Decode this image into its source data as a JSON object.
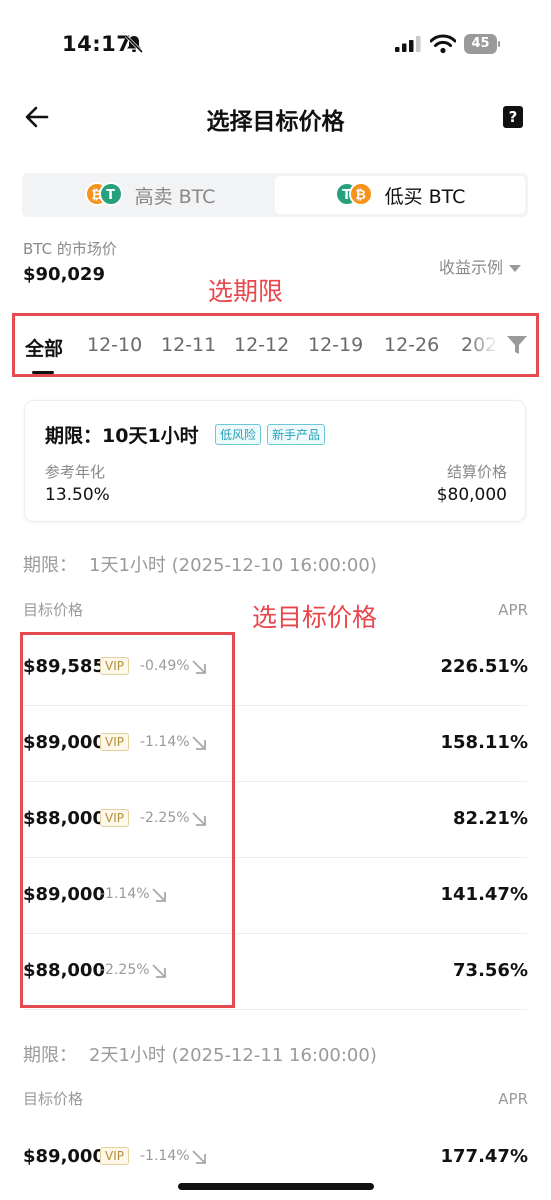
{
  "status_bar": {
    "time": "14:17",
    "battery": "45"
  },
  "nav": {
    "title": "选择目标价格"
  },
  "segment": {
    "left_label": "高卖 BTC",
    "right_label": "低买 BTC"
  },
  "market": {
    "label": "BTC 的市场价",
    "price": "$90,029",
    "example_label": "收益示例"
  },
  "annotations": {
    "choose_term": "选期限",
    "choose_target": "选目标价格"
  },
  "tabs": [
    "全部",
    "12-10",
    "12-11",
    "12-12",
    "12-19",
    "12-26",
    "202"
  ],
  "product_card": {
    "term": "期限：10天1小时",
    "tags": [
      "低风险",
      "新手产品"
    ],
    "ref_label": "参考年化",
    "ref_value": "13.50%",
    "settle_label": "结算价格",
    "settle_value": "$80,000"
  },
  "sections": [
    {
      "label": "期限：",
      "term": "1天1小时",
      "date": "(2025-12-10 16:00:00)",
      "col_target": "目标价格",
      "col_apr": "APR",
      "rows": [
        {
          "price": "$89,585",
          "vip": "VIP",
          "change": "-0.49%",
          "apr": "226.51%"
        },
        {
          "price": "$89,000",
          "vip": "VIP",
          "change": "-1.14%",
          "apr": "158.11%"
        },
        {
          "price": "$88,000",
          "vip": "VIP",
          "change": "-2.25%",
          "apr": "82.21%"
        },
        {
          "price": "$89,000",
          "vip": "",
          "change": "-1.14%",
          "apr": "141.47%"
        },
        {
          "price": "$88,000",
          "vip": "",
          "change": "-2.25%",
          "apr": "73.56%"
        }
      ]
    },
    {
      "label": "期限：",
      "term": "2天1小时",
      "date": "(2025-12-11 16:00:00)",
      "col_target": "目标价格",
      "col_apr": "APR",
      "rows": [
        {
          "price": "$89,000",
          "vip": "VIP",
          "change": "-1.14%",
          "apr": "177.47%"
        }
      ]
    }
  ],
  "icons": {
    "back": "arrow-left-icon",
    "help": "help-book-icon",
    "filter": "filter-icon",
    "down_trend": "arrow-down-right-icon"
  },
  "colors": {
    "annotation_red": "#e44a4f",
    "btc": "#f7931a",
    "usdt": "#26a17b",
    "tag_teal": "#21a3b8",
    "vip_gold": "#b48f3a"
  }
}
